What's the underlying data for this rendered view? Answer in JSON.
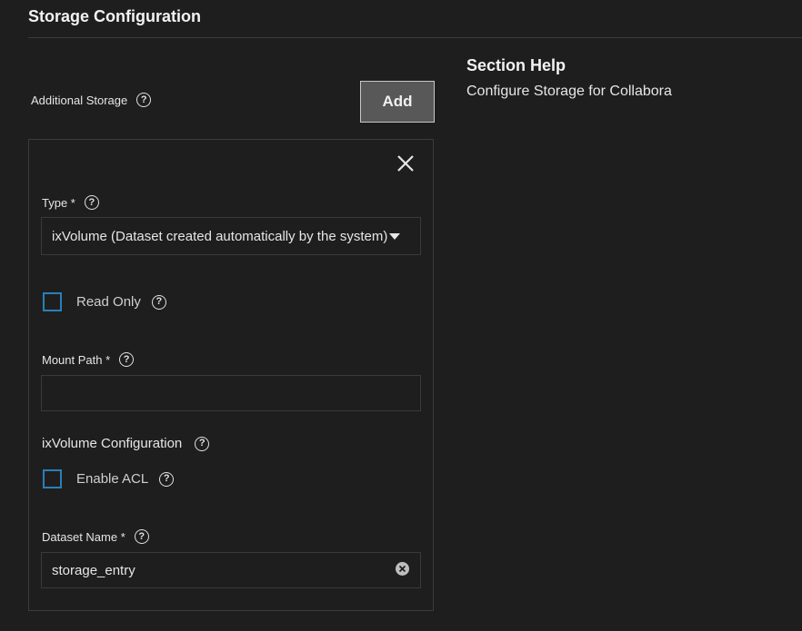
{
  "section": {
    "title": "Storage Configuration"
  },
  "additional_storage": {
    "label": "Additional Storage",
    "help_glyph": "?",
    "add_label": "Add"
  },
  "help_panel": {
    "title": "Section Help",
    "text": "Configure Storage for Collabora"
  },
  "storage_entry": {
    "type": {
      "label": "Type *",
      "selected": "ixVolume (Dataset created automatically by the system)",
      "help_glyph": "?"
    },
    "read_only": {
      "label": "Read Only",
      "checked": false,
      "help_glyph": "?"
    },
    "mount_path": {
      "label": "Mount Path *",
      "value": "",
      "help_glyph": "?"
    },
    "ixvolume_config": {
      "label": "ixVolume Configuration",
      "help_glyph": "?"
    },
    "enable_acl": {
      "label": "Enable ACL",
      "checked": false,
      "help_glyph": "?"
    },
    "dataset_name": {
      "label": "Dataset Name *",
      "value": "storage_entry",
      "help_glyph": "?"
    }
  },
  "icons": {
    "close": "close-icon",
    "help": "help-icon",
    "dropdown": "chevron-down-icon",
    "clear": "clear-icon"
  },
  "colors": {
    "background": "#1e1e1e",
    "checkbox_border": "#2a7fb8",
    "button_bg": "#585858"
  }
}
